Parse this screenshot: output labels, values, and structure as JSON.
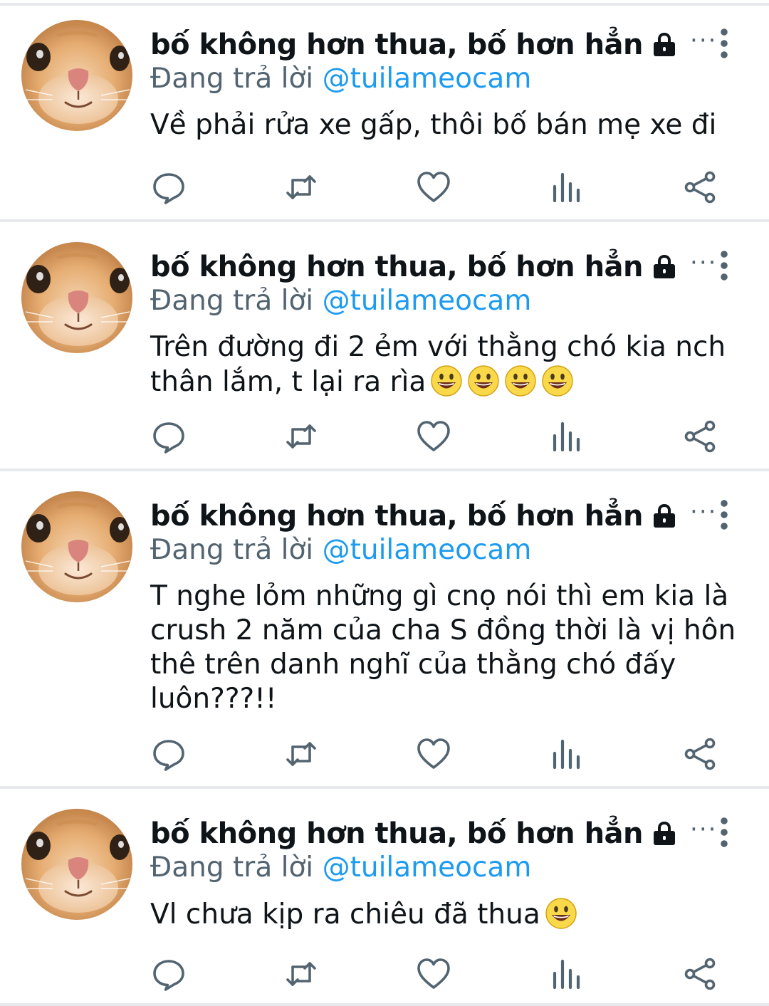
{
  "feed": {
    "colors": {
      "name": "#0f1419",
      "muted": "#536471",
      "link": "#1d9bf0",
      "icon": "#536471",
      "divider": "#e7e9ec",
      "emoji": "#f9d84a"
    },
    "tweets": [
      {
        "display_name": "bố không hơn thua, bố hơn hẳn",
        "reply_prefix": "Đang trả lời",
        "reply_handle": "@tuilameocam",
        "ellipsis": "···",
        "text": "Về phải rửa xe gấp, thôi bố bán mẹ xe đi",
        "emojis": []
      },
      {
        "display_name": "bố không hơn thua, bố hơn hẳn",
        "reply_prefix": "Đang trả lời",
        "reply_handle": "@tuilameocam",
        "ellipsis": "···",
        "text": "Trên đường đi 2 ẻm với thằng chó kia nch\nthân lắm, t lại ra rìa",
        "emojis": [
          "grinning-face",
          "grinning-face",
          "grinning-face",
          "grinning-face"
        ]
      },
      {
        "display_name": "bố không hơn thua, bố hơn hẳn",
        "reply_prefix": "Đang trả lời",
        "reply_handle": "@tuilameocam",
        "ellipsis": "···",
        "text": "T nghe lỏm những gì cnọ nói thì em kia là\ncrush 2 năm của cha S đồng thời là vị hôn\nthê trên danh nghĩ của thằng chó đấy\nluôn???!!",
        "emojis": []
      },
      {
        "display_name": "bố không hơn thua, bố hơn hẳn",
        "reply_prefix": "Đang trả lời",
        "reply_handle": "@tuilameocam",
        "ellipsis": "···",
        "text": "Vl chưa kịp ra chiêu đã thua",
        "emojis": [
          "grinning-face"
        ]
      }
    ],
    "action_icons": [
      "reply-icon",
      "retweet-icon",
      "like-icon",
      "views-icon",
      "share-icon"
    ],
    "header_icons": [
      "lock-icon",
      "more-vertical-icon"
    ]
  }
}
